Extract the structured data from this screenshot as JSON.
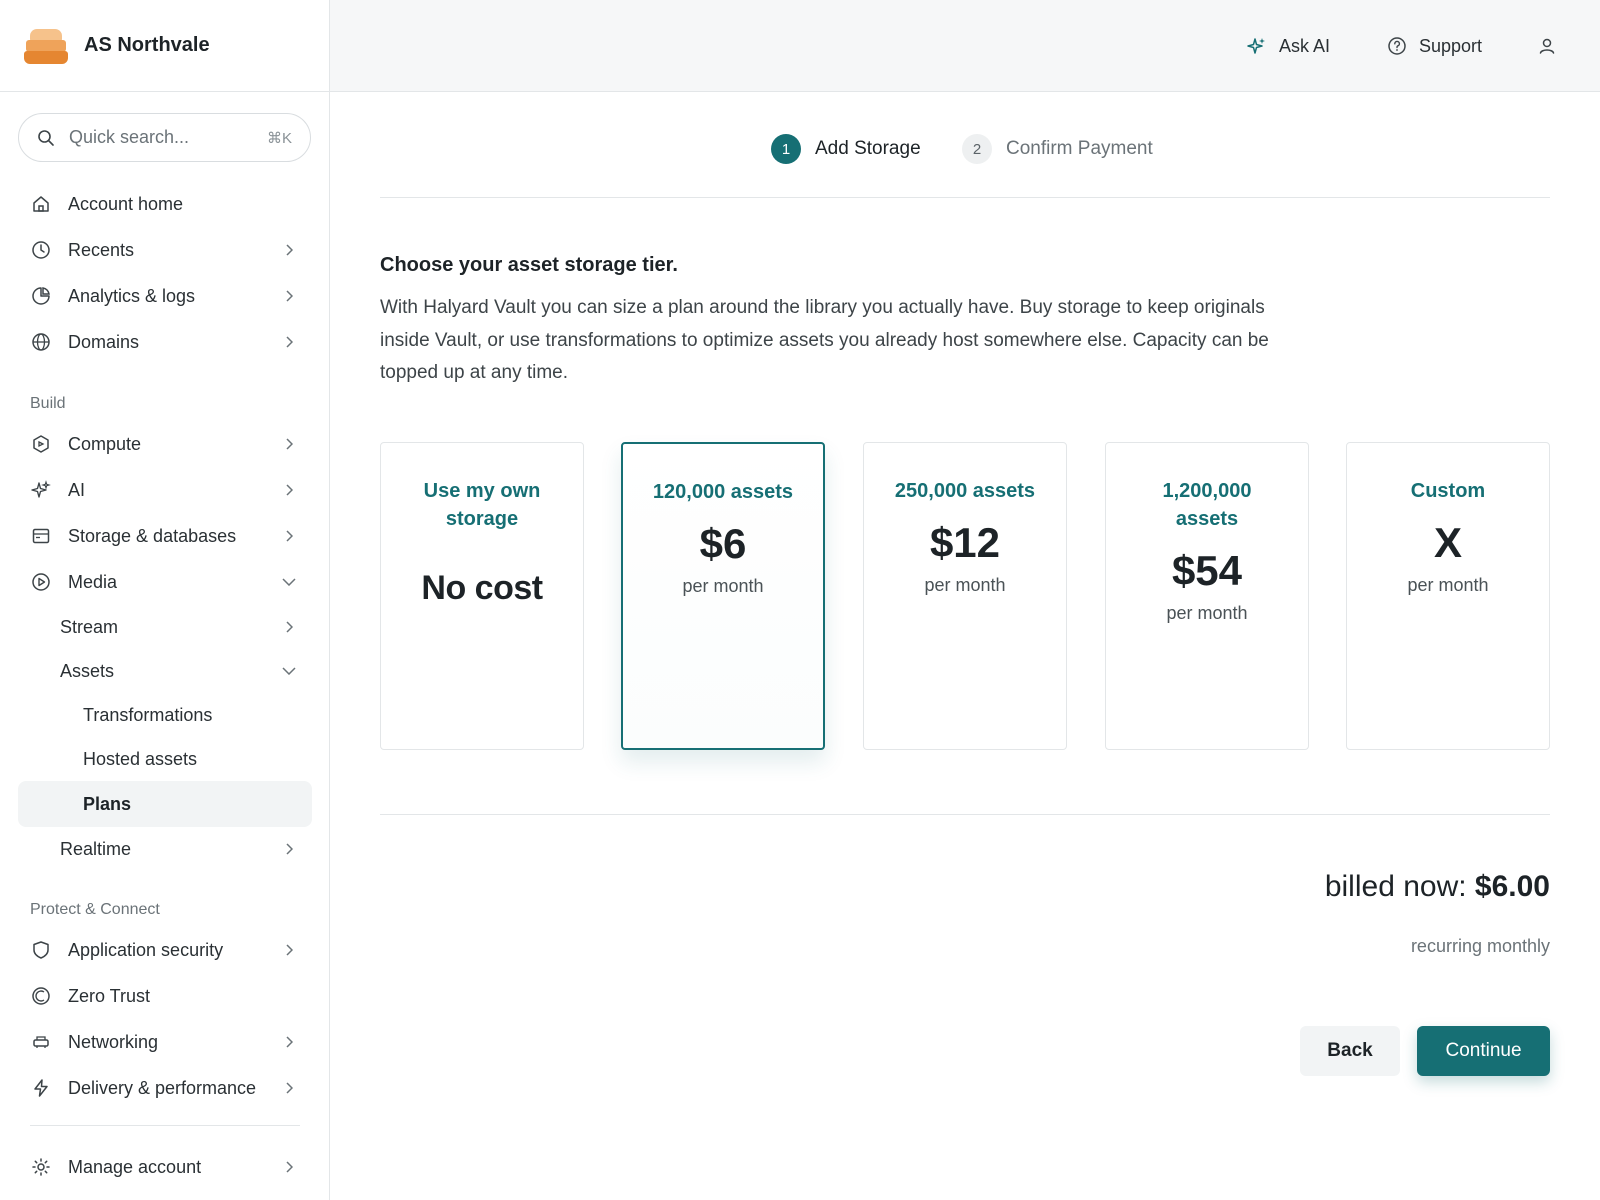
{
  "brand": {
    "name": "AS Northvale"
  },
  "search": {
    "placeholder": "Quick search...",
    "shortcut": "⌘K"
  },
  "sidebar": {
    "top_items": [
      {
        "label": "Account home",
        "icon": "home-icon",
        "has_chevron": false
      },
      {
        "label": "Recents",
        "icon": "clock-icon",
        "has_chevron": true
      },
      {
        "label": "Analytics & logs",
        "icon": "pie-chart-icon",
        "has_chevron": true
      },
      {
        "label": "Domains",
        "icon": "globe-icon",
        "has_chevron": true
      }
    ],
    "build_label": "Build",
    "build_items": [
      {
        "label": "Compute",
        "icon": "hexagon-icon",
        "chevron": "right"
      },
      {
        "label": "AI",
        "icon": "sparkle-icon",
        "chevron": "right"
      },
      {
        "label": "Storage & databases",
        "icon": "database-icon",
        "chevron": "right"
      },
      {
        "label": "Media",
        "icon": "play-circle-icon",
        "chevron": "down"
      }
    ],
    "media_children": [
      {
        "label": "Stream",
        "chevron": "right"
      },
      {
        "label": "Assets",
        "chevron": "down"
      }
    ],
    "assets_children": [
      {
        "label": "Transformations"
      },
      {
        "label": "Hosted assets"
      },
      {
        "label": "Plans",
        "active": true
      }
    ],
    "realtime": {
      "label": "Realtime",
      "chevron": "right"
    },
    "protect_label": "Protect & Connect",
    "protect_items": [
      {
        "label": "Application security",
        "icon": "shield-icon",
        "chevron": "right"
      },
      {
        "label": "Zero Trust",
        "icon": "zero-trust-icon",
        "chevron": "none"
      },
      {
        "label": "Networking",
        "icon": "router-icon",
        "chevron": "right"
      },
      {
        "label": "Delivery & performance",
        "icon": "bolt-icon",
        "chevron": "right"
      }
    ],
    "manage": {
      "label": "Manage account",
      "icon": "gear-icon",
      "chevron": "right"
    }
  },
  "topbar": {
    "ask_ai": "Ask AI",
    "support": "Support",
    "user_icon": "user-icon"
  },
  "stepper": {
    "steps": [
      {
        "number": "1",
        "label": "Add Storage",
        "active": true
      },
      {
        "number": "2",
        "label": "Confirm Payment",
        "active": false
      }
    ]
  },
  "main": {
    "heading": "Choose your asset storage tier.",
    "description": "With Halyard Vault you can size a plan around the library you actually have. Buy storage to keep originals inside Vault, or use transformations to optimize assets you already host somewhere else. Capacity can be topped up at any time."
  },
  "tiers": [
    {
      "title": "Use my own storage",
      "price": "No cost",
      "unit": "",
      "selected": false
    },
    {
      "title": "120,000 assets",
      "price": "$6",
      "unit": "per month",
      "selected": true
    },
    {
      "title": "250,000 assets",
      "price": "$12",
      "unit": "per month",
      "selected": false
    },
    {
      "title": "1,200,000 assets",
      "price": "$54",
      "unit": "per month",
      "selected": false
    },
    {
      "title": "Custom",
      "price": "X",
      "unit": "per month",
      "selected": false
    }
  ],
  "billing": {
    "billed_label": "billed now: ",
    "billed_amount": "$6.00",
    "recurring": "recurring monthly"
  },
  "actions": {
    "back": "Back",
    "continue": "Continue"
  },
  "colors": {
    "accent": "#166f74",
    "border": "#e3e6e8",
    "text": "#1d2327",
    "muted": "#6b7378"
  }
}
